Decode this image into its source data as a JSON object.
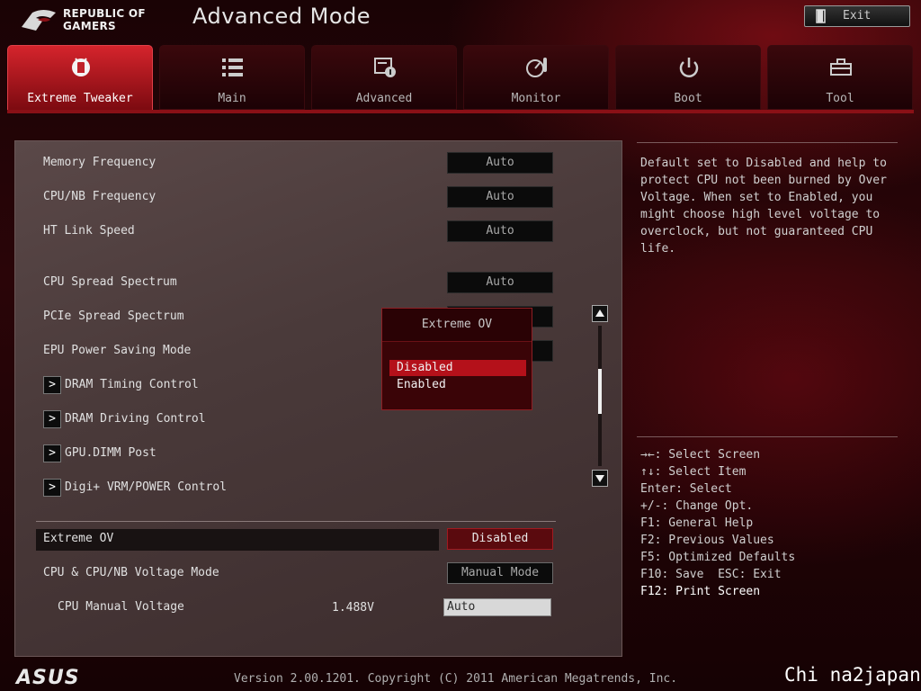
{
  "header": {
    "brand_line1": "REPUBLIC OF",
    "brand_line2": "GAMERS",
    "title": "Advanced Mode",
    "exit_label": "Exit"
  },
  "tabs": [
    {
      "label": "Extreme Tweaker",
      "icon": "tweaker-icon",
      "active": true
    },
    {
      "label": "Main",
      "icon": "list-icon",
      "active": false
    },
    {
      "label": "Advanced",
      "icon": "advanced-settings-icon",
      "active": false
    },
    {
      "label": "Monitor",
      "icon": "monitor-gauge-icon",
      "active": false
    },
    {
      "label": "Boot",
      "icon": "power-icon",
      "active": false
    },
    {
      "label": "Tool",
      "icon": "toolbox-icon",
      "active": false
    }
  ],
  "settings": {
    "memory_frequency": {
      "label": "Memory Frequency",
      "value": "Auto"
    },
    "cpu_nb_frequency": {
      "label": "CPU/NB Frequency",
      "value": "Auto"
    },
    "ht_link_speed": {
      "label": "HT Link Speed",
      "value": "Auto"
    },
    "cpu_spread_spectrum": {
      "label": "CPU Spread Spectrum",
      "value": "Auto"
    },
    "pcie_spread_spectrum": {
      "label": "PCIe Spread Spectrum"
    },
    "epu_power_saving": {
      "label": "EPU Power Saving Mode"
    },
    "extreme_ov": {
      "label": "Extreme OV",
      "value": "Disabled"
    },
    "voltage_mode": {
      "label": "CPU & CPU/NB Voltage Mode",
      "value": "Manual Mode"
    },
    "cpu_manual_voltage": {
      "label": "CPU Manual Voltage",
      "reading": "1.488V",
      "value": "Auto"
    }
  },
  "submenus": [
    {
      "label": "DRAM Timing Control"
    },
    {
      "label": "DRAM Driving Control"
    },
    {
      "label": "GPU.DIMM Post"
    },
    {
      "label": "Digi+ VRM/POWER Control"
    }
  ],
  "submenu_arrow": ">",
  "popup": {
    "title": "Extreme OV",
    "options": [
      "Disabled",
      "Enabled"
    ],
    "selected": "Disabled"
  },
  "help": {
    "text": "Default set to Disabled and help to\nprotect CPU not been burned by Over\nVoltage. When set to Enabled, you\nmight choose high level voltage to\noverclock, but not guaranteed CPU\nlife.",
    "keys": [
      "→←: Select Screen",
      "↑↓: Select Item",
      "Enter: Select",
      "+/-: Change Opt.",
      "F1: General Help",
      "F2: Previous Values",
      "F5: Optimized Defaults",
      "F10: Save  ESC: Exit",
      "F12: Print Screen"
    ]
  },
  "footer": {
    "logo": "ASUS",
    "version_text": "Version 2.00.1201. Copyright (C) 2011 American Megatrends, Inc.",
    "watermark": "Chi na2japan"
  },
  "colors": {
    "accent_red": "#d5242c",
    "selected_option": "#b4111a"
  }
}
